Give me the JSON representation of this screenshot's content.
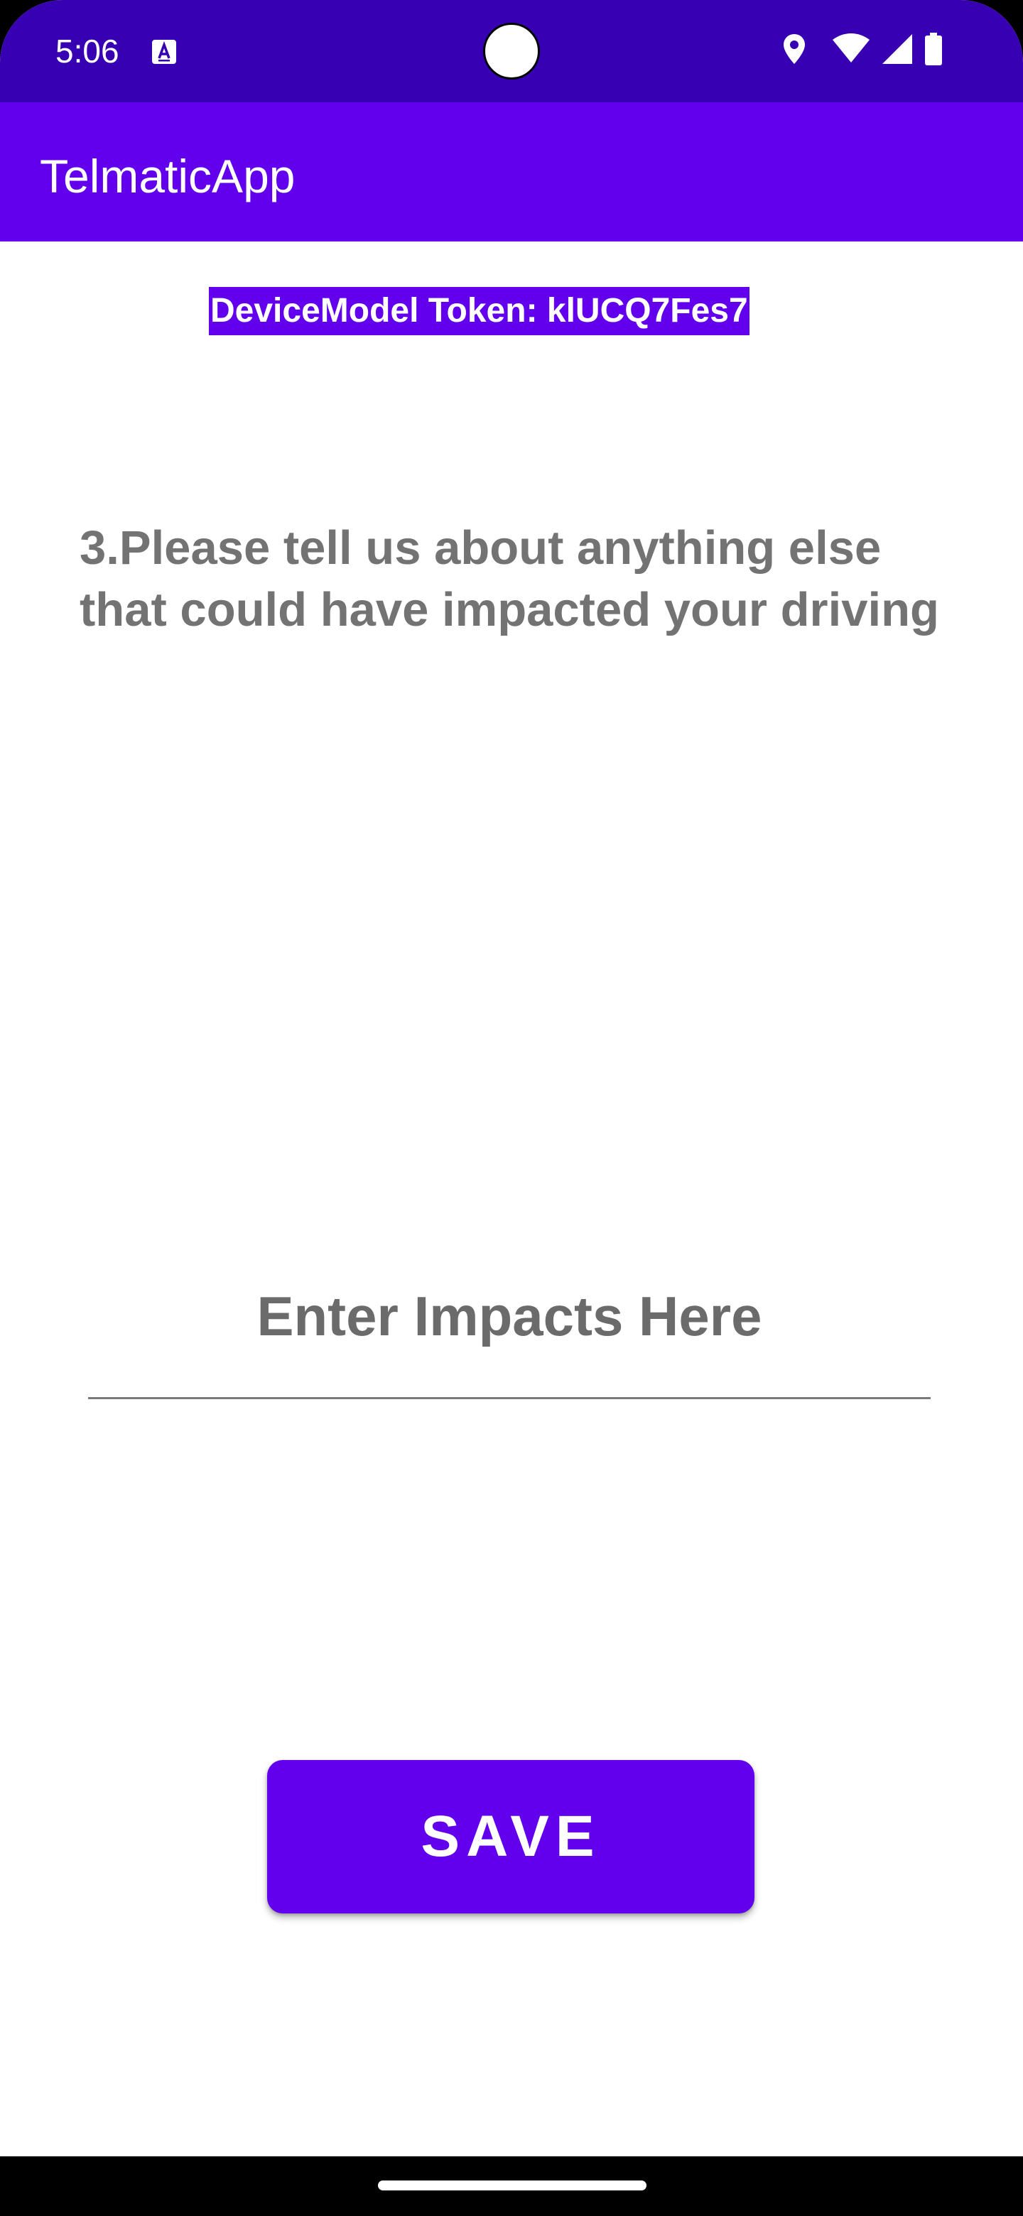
{
  "status_bar": {
    "time": "5:06",
    "icons": [
      "notification-a-icon",
      "location-icon",
      "wifi-icon",
      "signal-icon",
      "battery-icon"
    ]
  },
  "app_bar": {
    "title": "TelmaticApp"
  },
  "token": {
    "label": "DeviceModel Token: klUCQ7Fes7"
  },
  "question": {
    "text": "3.Please tell us about anything else that could have impacted your driving"
  },
  "impact_input": {
    "placeholder": "Enter Impacts Here",
    "value": ""
  },
  "save_button": {
    "label": "SAVE"
  },
  "colors": {
    "status_bar": "#3700b3",
    "primary": "#6200ee",
    "question_text": "#737373",
    "background": "#ffffff"
  }
}
